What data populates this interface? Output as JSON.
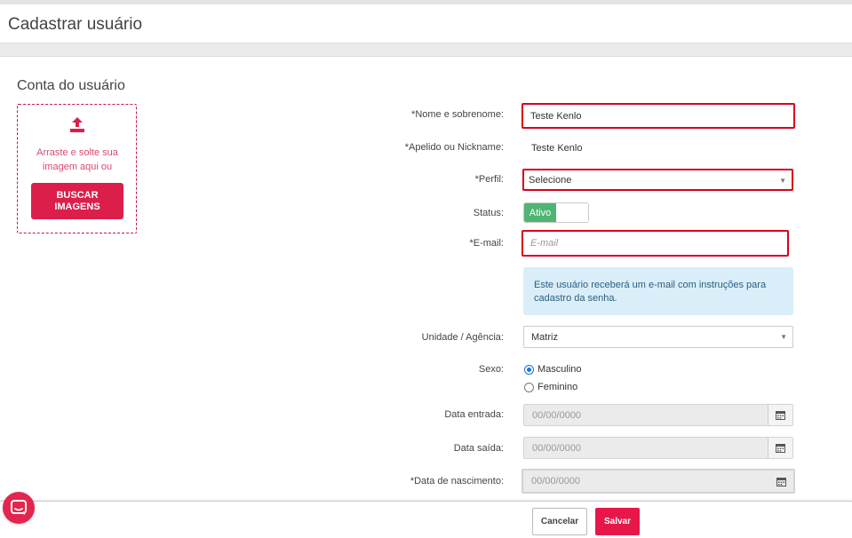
{
  "header": {
    "title": "Cadastrar usuário"
  },
  "account": {
    "section_title": "Conta do usuário",
    "dropzone_text": "Arraste e solte sua imagem aqui ou",
    "browse_button": "BUSCAR IMAGENS"
  },
  "form": {
    "name": {
      "label": "*Nome e sobrenome:",
      "value": "Teste Kenlo"
    },
    "nickname": {
      "label": "*Apelido ou Nickname:",
      "value": "Teste Kenlo"
    },
    "profile": {
      "label": "*Perfil:",
      "value": "Selecione"
    },
    "status": {
      "label": "Status:",
      "value": "Ativo"
    },
    "email": {
      "label": "*E-mail:",
      "placeholder": "E-mail"
    },
    "email_info": "Este usuário receberá um e-mail com instruções para cadastro da senha.",
    "unit": {
      "label": "Unidade / Agência:",
      "value": "Matriz"
    },
    "sex": {
      "label": "Sexo:",
      "options": [
        "Masculino",
        "Feminino"
      ],
      "selected": "Masculino"
    },
    "entry_date": {
      "label": "Data entrada:",
      "placeholder": "00/00/0000"
    },
    "exit_date": {
      "label": "Data saída:",
      "placeholder": "00/00/0000"
    },
    "birth_date": {
      "label": "*Data de nascimento:",
      "placeholder": "00/00/0000"
    }
  },
  "footer": {
    "cancel_label": "Cancelar",
    "save_label": "Salvar"
  },
  "colors": {
    "accent": "#dc1e4b",
    "highlight": "#d8001f",
    "status_on": "#4fb574",
    "info_bg": "#d9eef8"
  },
  "icons": {
    "upload": "upload-icon",
    "calendar": "calendar-icon",
    "chat": "chat-icon",
    "caret": "caret-down-icon"
  }
}
